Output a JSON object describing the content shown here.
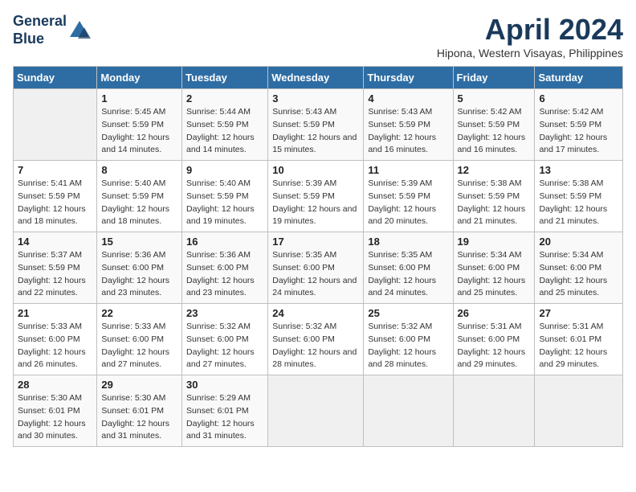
{
  "header": {
    "logo_line1": "General",
    "logo_line2": "Blue",
    "month_title": "April 2024",
    "location": "Hipona, Western Visayas, Philippines"
  },
  "days_of_week": [
    "Sunday",
    "Monday",
    "Tuesday",
    "Wednesday",
    "Thursday",
    "Friday",
    "Saturday"
  ],
  "weeks": [
    [
      {
        "day": "",
        "sunrise": "",
        "sunset": "",
        "daylight": ""
      },
      {
        "day": "1",
        "sunrise": "Sunrise: 5:45 AM",
        "sunset": "Sunset: 5:59 PM",
        "daylight": "Daylight: 12 hours and 14 minutes."
      },
      {
        "day": "2",
        "sunrise": "Sunrise: 5:44 AM",
        "sunset": "Sunset: 5:59 PM",
        "daylight": "Daylight: 12 hours and 14 minutes."
      },
      {
        "day": "3",
        "sunrise": "Sunrise: 5:43 AM",
        "sunset": "Sunset: 5:59 PM",
        "daylight": "Daylight: 12 hours and 15 minutes."
      },
      {
        "day": "4",
        "sunrise": "Sunrise: 5:43 AM",
        "sunset": "Sunset: 5:59 PM",
        "daylight": "Daylight: 12 hours and 16 minutes."
      },
      {
        "day": "5",
        "sunrise": "Sunrise: 5:42 AM",
        "sunset": "Sunset: 5:59 PM",
        "daylight": "Daylight: 12 hours and 16 minutes."
      },
      {
        "day": "6",
        "sunrise": "Sunrise: 5:42 AM",
        "sunset": "Sunset: 5:59 PM",
        "daylight": "Daylight: 12 hours and 17 minutes."
      }
    ],
    [
      {
        "day": "7",
        "sunrise": "Sunrise: 5:41 AM",
        "sunset": "Sunset: 5:59 PM",
        "daylight": "Daylight: 12 hours and 18 minutes."
      },
      {
        "day": "8",
        "sunrise": "Sunrise: 5:40 AM",
        "sunset": "Sunset: 5:59 PM",
        "daylight": "Daylight: 12 hours and 18 minutes."
      },
      {
        "day": "9",
        "sunrise": "Sunrise: 5:40 AM",
        "sunset": "Sunset: 5:59 PM",
        "daylight": "Daylight: 12 hours and 19 minutes."
      },
      {
        "day": "10",
        "sunrise": "Sunrise: 5:39 AM",
        "sunset": "Sunset: 5:59 PM",
        "daylight": "Daylight: 12 hours and 19 minutes."
      },
      {
        "day": "11",
        "sunrise": "Sunrise: 5:39 AM",
        "sunset": "Sunset: 5:59 PM",
        "daylight": "Daylight: 12 hours and 20 minutes."
      },
      {
        "day": "12",
        "sunrise": "Sunrise: 5:38 AM",
        "sunset": "Sunset: 5:59 PM",
        "daylight": "Daylight: 12 hours and 21 minutes."
      },
      {
        "day": "13",
        "sunrise": "Sunrise: 5:38 AM",
        "sunset": "Sunset: 5:59 PM",
        "daylight": "Daylight: 12 hours and 21 minutes."
      }
    ],
    [
      {
        "day": "14",
        "sunrise": "Sunrise: 5:37 AM",
        "sunset": "Sunset: 5:59 PM",
        "daylight": "Daylight: 12 hours and 22 minutes."
      },
      {
        "day": "15",
        "sunrise": "Sunrise: 5:36 AM",
        "sunset": "Sunset: 6:00 PM",
        "daylight": "Daylight: 12 hours and 23 minutes."
      },
      {
        "day": "16",
        "sunrise": "Sunrise: 5:36 AM",
        "sunset": "Sunset: 6:00 PM",
        "daylight": "Daylight: 12 hours and 23 minutes."
      },
      {
        "day": "17",
        "sunrise": "Sunrise: 5:35 AM",
        "sunset": "Sunset: 6:00 PM",
        "daylight": "Daylight: 12 hours and 24 minutes."
      },
      {
        "day": "18",
        "sunrise": "Sunrise: 5:35 AM",
        "sunset": "Sunset: 6:00 PM",
        "daylight": "Daylight: 12 hours and 24 minutes."
      },
      {
        "day": "19",
        "sunrise": "Sunrise: 5:34 AM",
        "sunset": "Sunset: 6:00 PM",
        "daylight": "Daylight: 12 hours and 25 minutes."
      },
      {
        "day": "20",
        "sunrise": "Sunrise: 5:34 AM",
        "sunset": "Sunset: 6:00 PM",
        "daylight": "Daylight: 12 hours and 25 minutes."
      }
    ],
    [
      {
        "day": "21",
        "sunrise": "Sunrise: 5:33 AM",
        "sunset": "Sunset: 6:00 PM",
        "daylight": "Daylight: 12 hours and 26 minutes."
      },
      {
        "day": "22",
        "sunrise": "Sunrise: 5:33 AM",
        "sunset": "Sunset: 6:00 PM",
        "daylight": "Daylight: 12 hours and 27 minutes."
      },
      {
        "day": "23",
        "sunrise": "Sunrise: 5:32 AM",
        "sunset": "Sunset: 6:00 PM",
        "daylight": "Daylight: 12 hours and 27 minutes."
      },
      {
        "day": "24",
        "sunrise": "Sunrise: 5:32 AM",
        "sunset": "Sunset: 6:00 PM",
        "daylight": "Daylight: 12 hours and 28 minutes."
      },
      {
        "day": "25",
        "sunrise": "Sunrise: 5:32 AM",
        "sunset": "Sunset: 6:00 PM",
        "daylight": "Daylight: 12 hours and 28 minutes."
      },
      {
        "day": "26",
        "sunrise": "Sunrise: 5:31 AM",
        "sunset": "Sunset: 6:00 PM",
        "daylight": "Daylight: 12 hours and 29 minutes."
      },
      {
        "day": "27",
        "sunrise": "Sunrise: 5:31 AM",
        "sunset": "Sunset: 6:01 PM",
        "daylight": "Daylight: 12 hours and 29 minutes."
      }
    ],
    [
      {
        "day": "28",
        "sunrise": "Sunrise: 5:30 AM",
        "sunset": "Sunset: 6:01 PM",
        "daylight": "Daylight: 12 hours and 30 minutes."
      },
      {
        "day": "29",
        "sunrise": "Sunrise: 5:30 AM",
        "sunset": "Sunset: 6:01 PM",
        "daylight": "Daylight: 12 hours and 31 minutes."
      },
      {
        "day": "30",
        "sunrise": "Sunrise: 5:29 AM",
        "sunset": "Sunset: 6:01 PM",
        "daylight": "Daylight: 12 hours and 31 minutes."
      },
      {
        "day": "",
        "sunrise": "",
        "sunset": "",
        "daylight": ""
      },
      {
        "day": "",
        "sunrise": "",
        "sunset": "",
        "daylight": ""
      },
      {
        "day": "",
        "sunrise": "",
        "sunset": "",
        "daylight": ""
      },
      {
        "day": "",
        "sunrise": "",
        "sunset": "",
        "daylight": ""
      }
    ]
  ]
}
